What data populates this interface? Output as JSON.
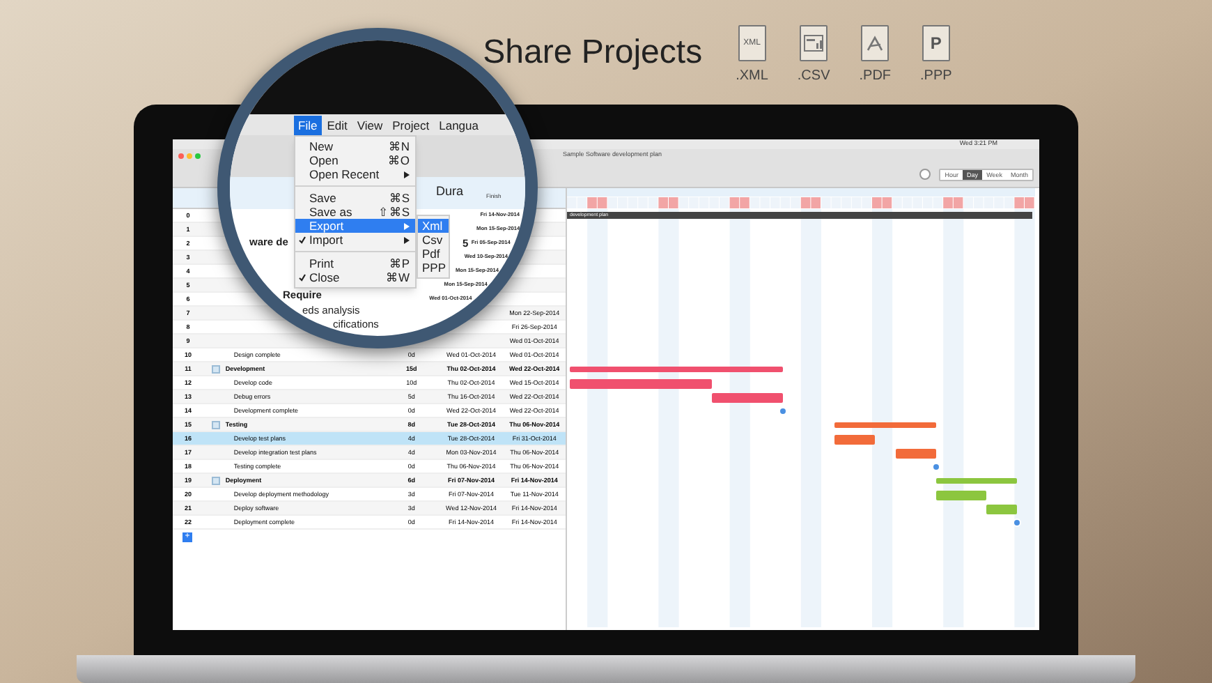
{
  "headline": "Share Projects",
  "formats": [
    {
      "kind": "text",
      "icon_text": "XML",
      "label": ".XML"
    },
    {
      "kind": "sheet",
      "label": ".CSV"
    },
    {
      "kind": "pdf",
      "label": ".PDF"
    },
    {
      "kind": "letter",
      "icon_text": "P",
      "label": ".PPP"
    }
  ],
  "system_bar": {
    "clock": "Wed 3:21 PM"
  },
  "window": {
    "title": "Sample Software development plan"
  },
  "scale_tabs": [
    {
      "label": "Hour",
      "selected": false
    },
    {
      "label": "Day",
      "selected": true
    },
    {
      "label": "Week",
      "selected": false
    },
    {
      "label": "Month",
      "selected": false
    }
  ],
  "table": {
    "rows": [
      {
        "number": "0"
      },
      {
        "number": "1"
      },
      {
        "number": "2"
      },
      {
        "number": "3"
      },
      {
        "number": "4"
      },
      {
        "number": "5"
      },
      {
        "number": "6"
      },
      {
        "number": "7",
        "finish": "Mon 22-Sep-2014"
      },
      {
        "number": "8",
        "finish": "Fri 26-Sep-2014"
      },
      {
        "number": "9",
        "finish": "Wed 01-Oct-2014"
      },
      {
        "number": "10",
        "kind": "milestone",
        "name": "Design complete",
        "duration": "0d",
        "start": "Wed 01-Oct-2014",
        "finish": "Wed 01-Oct-2014",
        "selected": false
      },
      {
        "number": "11",
        "kind": "summary",
        "name": "Development",
        "duration": "15d",
        "start": "Thu 02-Oct-2014",
        "finish": "Wed 22-Oct-2014",
        "color": "#f0506e",
        "selected": false
      },
      {
        "number": "12",
        "kind": "task",
        "name": "Develop code",
        "duration": "10d",
        "start": "Thu 02-Oct-2014",
        "finish": "Wed 15-Oct-2014",
        "color": "#f0506e",
        "selected": false
      },
      {
        "number": "13",
        "kind": "task",
        "name": "Debug errors",
        "duration": "5d",
        "start": "Thu 16-Oct-2014",
        "finish": "Wed 22-Oct-2014",
        "color": "#f0506e",
        "selected": false
      },
      {
        "number": "14",
        "kind": "milestone",
        "name": "Development complete",
        "duration": "0d",
        "start": "Wed 22-Oct-2014",
        "finish": "Wed 22-Oct-2014",
        "selected": false
      },
      {
        "number": "15",
        "kind": "summary",
        "name": "Testing",
        "duration": "8d",
        "start": "Tue 28-Oct-2014",
        "finish": "Thu 06-Nov-2014",
        "color": "#f26b3a",
        "selected": false
      },
      {
        "number": "16",
        "kind": "task",
        "name": "Develop test plans",
        "duration": "4d",
        "start": "Tue 28-Oct-2014",
        "finish": "Fri 31-Oct-2014",
        "color": "#f26b3a",
        "selected": true
      },
      {
        "number": "17",
        "kind": "task",
        "name": "Develop integration test plans",
        "duration": "4d",
        "start": "Mon 03-Nov-2014",
        "finish": "Thu 06-Nov-2014",
        "color": "#f26b3a",
        "selected": false
      },
      {
        "number": "18",
        "kind": "milestone",
        "name": "Testing complete",
        "duration": "0d",
        "start": "Thu 06-Nov-2014",
        "finish": "Thu 06-Nov-2014",
        "selected": false
      },
      {
        "number": "19",
        "kind": "summary",
        "name": "Deployment",
        "duration": "6d",
        "start": "Fri 07-Nov-2014",
        "finish": "Fri 14-Nov-2014",
        "color": "#8cc63f",
        "selected": false
      },
      {
        "number": "20",
        "kind": "task",
        "name": "Develop deployment methodology",
        "duration": "3d",
        "start": "Fri 07-Nov-2014",
        "finish": "Tue 11-Nov-2014",
        "color": "#8cc63f",
        "selected": false
      },
      {
        "number": "21",
        "kind": "task",
        "name": "Deploy software",
        "duration": "3d",
        "start": "Wed 12-Nov-2014",
        "finish": "Fri 14-Nov-2014",
        "color": "#8cc63f",
        "selected": false
      },
      {
        "number": "22",
        "kind": "milestone",
        "name": "Deployment complete",
        "duration": "0d",
        "start": "Fri 14-Nov-2014",
        "finish": "Fri 14-Nov-2014",
        "selected": false
      }
    ],
    "add_row": "+"
  },
  "gantt": {
    "plan_bar": "development plan"
  },
  "magnifier": {
    "menubar": [
      {
        "label": "File",
        "selected": true
      },
      {
        "label": "Edit",
        "selected": false
      },
      {
        "label": "View",
        "selected": false
      },
      {
        "label": "Project",
        "selected": false
      },
      {
        "label": "Langua",
        "selected": false
      }
    ],
    "menu": [
      {
        "kind": "item",
        "label": "New",
        "shortcut": "⌘N",
        "selected": false,
        "checked": false
      },
      {
        "kind": "item",
        "label": "Open",
        "shortcut": "⌘O",
        "selected": false,
        "checked": false
      },
      {
        "kind": "submenu",
        "label": "Open Recent",
        "selected": false,
        "checked": false
      },
      {
        "kind": "separator"
      },
      {
        "kind": "item",
        "label": "Save",
        "shortcut": "⌘S",
        "selected": false,
        "checked": false
      },
      {
        "kind": "item",
        "label": "Save as",
        "shortcut": "⇧⌘S",
        "selected": false,
        "checked": false
      },
      {
        "kind": "submenu",
        "label": "Export",
        "selected": true,
        "checked": false
      },
      {
        "kind": "submenu",
        "label": "Import",
        "selected": false,
        "checked": true
      },
      {
        "kind": "separator"
      },
      {
        "kind": "item",
        "label": "Print",
        "shortcut": "⌘P",
        "selected": false,
        "checked": false
      },
      {
        "kind": "item",
        "label": "Close",
        "shortcut": "⌘W",
        "selected": false,
        "checked": true
      }
    ],
    "submenu": [
      {
        "label": "Xml",
        "selected": true
      },
      {
        "label": "Csv",
        "selected": false
      },
      {
        "label": "Pdf",
        "selected": false
      },
      {
        "label": "PPP",
        "selected": false
      }
    ],
    "duration_header": "Dura",
    "finish_header": "Finish",
    "finish_dates": [
      "Fri 14-Nov-2014",
      "Mon 15-Sep-2014",
      "Fri 05-Sep-2014",
      "Wed 10-Sep-2014",
      "Mon 15-Sep-2014",
      "Mon 15-Sep-2014",
      "Wed 01-Oct-2014"
    ],
    "fragments": [
      {
        "kind": "bold",
        "text": "ware de"
      },
      {
        "kind": "bold",
        "text": "5"
      },
      {
        "kind": "bold",
        "text": "Require"
      },
      {
        "kind": "plain",
        "text": "eds analysis"
      },
      {
        "kind": "plain",
        "text": "cifications"
      }
    ]
  }
}
